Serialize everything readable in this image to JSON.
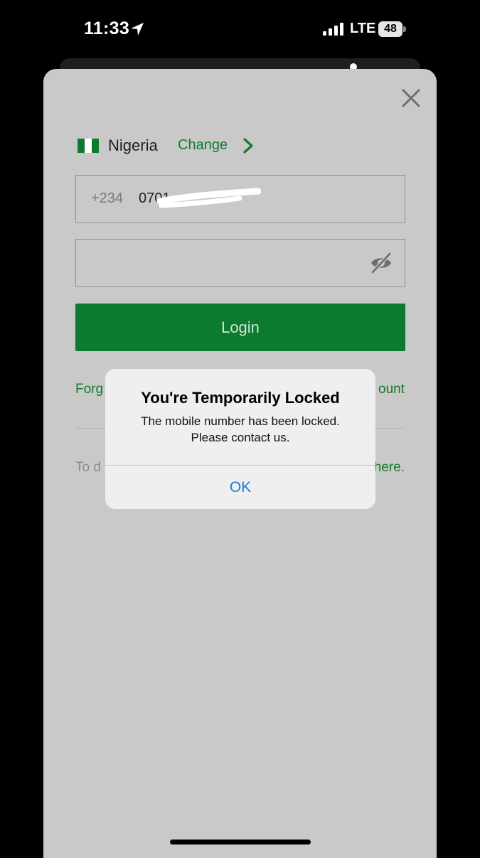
{
  "status_bar": {
    "time": "11:33",
    "network": "LTE",
    "battery": "48"
  },
  "login": {
    "country": "Nigeria",
    "change_label": "Change",
    "flag_colors": [
      "#0e7a2f",
      "#ffffff",
      "#0e7a2f"
    ],
    "dial_code": "+234",
    "phone_value": "0701",
    "password_value": "",
    "login_label": "Login",
    "forgot_link": "Forg",
    "create_account_link": "ount",
    "footer_text": "To d",
    "footer_link": "here."
  },
  "alert": {
    "title": "You're Temporarily Locked",
    "message_line1": "The mobile number has been locked.",
    "message_line2": "Please contact us.",
    "ok_label": "OK"
  },
  "colors": {
    "brand_green": "#0c7a2f",
    "link_green": "#137a2e",
    "alert_button_blue": "#1a7fe0"
  }
}
